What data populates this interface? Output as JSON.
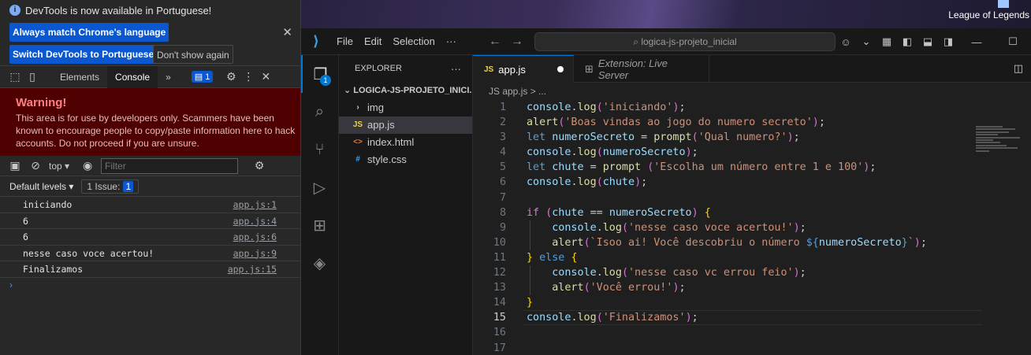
{
  "devtools": {
    "notice": {
      "message": "DevTools is now available in Portuguese!",
      "btn_match": "Always match Chrome's language",
      "btn_switch": "Switch DevTools to Portuguese",
      "btn_dismiss": "Don't show again"
    },
    "tabs": {
      "elements": "Elements",
      "console": "Console",
      "more": "»",
      "issues_count": "1"
    },
    "warning": {
      "title": "Warning!",
      "body": "This area is for use by developers only. Scammers have been known to encourage people to copy/paste information here to hack accounts. Do not proceed if you are unsure."
    },
    "console_toolbar": {
      "context": "top ▾",
      "filter_placeholder": "Filter",
      "levels": "Default levels ▾",
      "issues_label": "1 Issue:",
      "issues_count": "1"
    },
    "logs": [
      {
        "text": "iniciando",
        "source": "app.js:1"
      },
      {
        "text": "6",
        "source": "app.js:4"
      },
      {
        "text": "6",
        "source": "app.js:6"
      },
      {
        "text": "nesse caso voce acertou!",
        "source": "app.js:9"
      },
      {
        "text": "Finalizamos",
        "source": "app.js:15"
      }
    ],
    "prompt": "›"
  },
  "desktop": {
    "shortcut_label": "League of Legends"
  },
  "vscode": {
    "menu": {
      "file": "File",
      "edit": "Edit",
      "selection": "Selection",
      "more": "···"
    },
    "search": "logica-js-projeto_inicial",
    "explorer": {
      "header": "EXPLORER",
      "more": "···",
      "folder": "LOGICA-JS-PROJETO_INICI...",
      "items": [
        {
          "name": "img",
          "kind": "folder"
        },
        {
          "name": "app.js",
          "kind": "js"
        },
        {
          "name": "index.html",
          "kind": "html"
        },
        {
          "name": "style.css",
          "kind": "css"
        }
      ]
    },
    "activity_badge": "1",
    "tabs": {
      "active": "app.js",
      "extension": "Extension: Live Server"
    },
    "breadcrumb": "JS app.js > ...",
    "code_lines": [
      "console.log('iniciando');",
      "alert('Boas vindas ao jogo do numero secreto');",
      "let numeroSecreto = prompt('Qual numero?');",
      "console.log(numeroSecreto);",
      "let chute = prompt ('Escolha um número entre 1 e 100');",
      "console.log(chute);",
      "",
      "if (chute == numeroSecreto) {",
      "    console.log('nesse caso voce acertou!');",
      "    alert(`Isoo ai! Você descobriu o número ${numeroSecreto}`);",
      "} else {",
      "    console.log('nesse caso vc errou feio');",
      "    alert('Você errou!');",
      "}",
      "console.log('Finalizamos');",
      "",
      ""
    ],
    "current_line": 15
  }
}
